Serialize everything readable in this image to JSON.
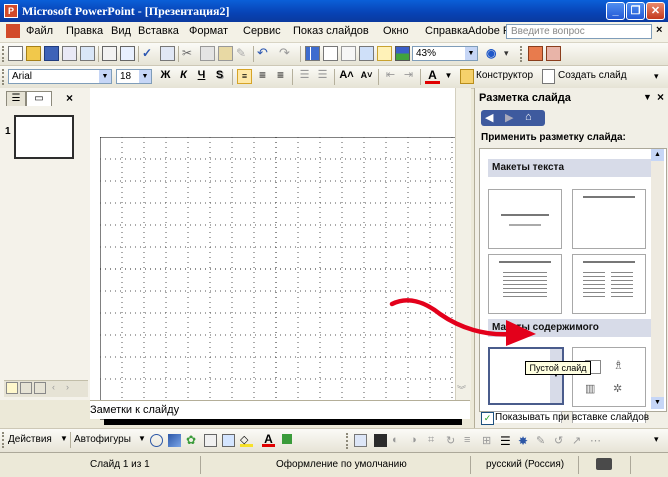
{
  "window": {
    "title": "Microsoft PowerPoint - [Презентация2]",
    "icon": "powerpoint-icon",
    "controls": [
      "minimize-icon",
      "restore-icon",
      "close-icon"
    ]
  },
  "menubar": {
    "items": [
      "Файл",
      "Правка",
      "Вид",
      "Вставка",
      "Формат",
      "Сервис",
      "Показ слайдов",
      "Окно",
      "Справка",
      "Adobe PDF"
    ],
    "ask_placeholder": "Введите вопрос"
  },
  "standard_toolbar": {
    "zoom": "43%"
  },
  "formatting_toolbar": {
    "font": "Arial",
    "font_size": "18",
    "bold": "Ж",
    "italic": "К",
    "underline": "Ч",
    "shadow": "S",
    "designer_label": "Конструктор",
    "new_slide_label": "Создать слайд"
  },
  "outline_pane": {
    "slide_number": "1"
  },
  "notes": {
    "placeholder": "Заметки к слайду"
  },
  "task_pane": {
    "title": "Разметка слайда",
    "apply_label": "Применить разметку слайда:",
    "text_layouts_header": "Макеты текста",
    "content_layouts_header": "Макеты содержимого",
    "tooltip": "Пустой слайд",
    "show_on_insert_label": "Показывать при вставке слайдов",
    "show_on_insert_checked": true
  },
  "drawing_toolbar": {
    "actions_label": "Действия",
    "autoshapes_label": "Автофигуры"
  },
  "statusbar": {
    "slide": "Слайд 1 из 1",
    "design": "Оформление по умолчанию",
    "language": "русский (Россия)"
  },
  "annotation": {
    "arrow_color": "#e3001b"
  }
}
